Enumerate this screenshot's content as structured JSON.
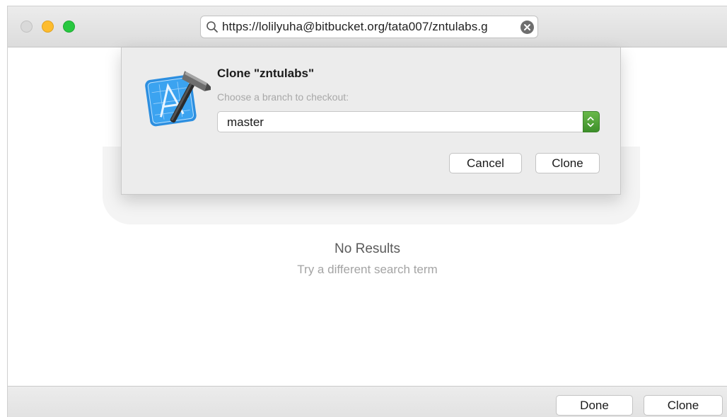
{
  "search": {
    "value": "https://lolilyuha@bitbucket.org/tata007/zntulabs.g"
  },
  "empty_state": {
    "title": "No Results",
    "subtitle": "Try a different search term"
  },
  "sheet": {
    "title": "Clone \"zntulabs\"",
    "subtitle": "Choose a branch to checkout:",
    "branch": "master",
    "cancel_label": "Cancel",
    "clone_label": "Clone"
  },
  "footer": {
    "done_label": "Done",
    "clone_label": "Clone"
  },
  "colors": {
    "accent_green": "#3d8f2a",
    "traffic_close": "#d9d9d9",
    "traffic_min": "#fdbc2e",
    "traffic_max": "#28c840"
  },
  "icons": {
    "search": "search-icon",
    "clear": "clear-icon",
    "app": "xcode-icon",
    "stepper": "chevron-updown-icon"
  }
}
